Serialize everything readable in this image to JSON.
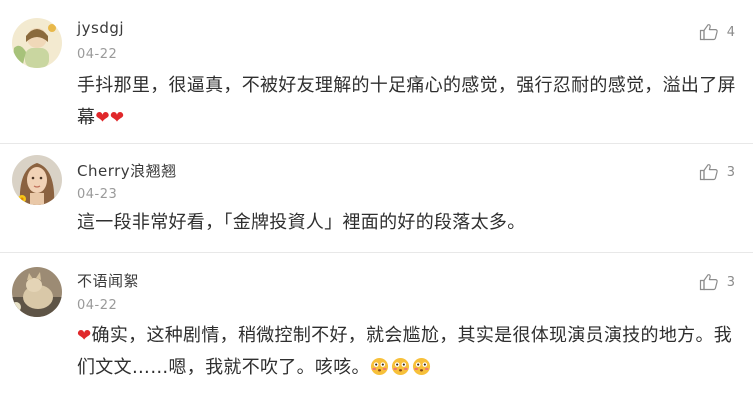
{
  "comments": [
    {
      "username": "jysdgj",
      "date": "04-22",
      "text": "手抖那里，很逼真，不被好友理解的十足痛心的感觉，强行忍耐的感觉，溢出了屏幕",
      "trailing_emoji": [
        "red-heart",
        "red-heart"
      ],
      "likes": "4",
      "avatar_icon": "avatar-illustration-icon"
    },
    {
      "username": "Cherry浪翘翘",
      "date": "04-23",
      "text": "這一段非常好看，「金牌投資人」裡面的好的段落太多。",
      "likes": "3",
      "avatar_icon": "avatar-portrait-icon"
    },
    {
      "username": "不语闻絮",
      "date": "04-22",
      "leading_emoji": "red-heart",
      "text": "确实，这种剧情，稍微控制不好，就会尴尬，其实是很体现演员演技的地方。我们文文……嗯，我就不吹了。咳咳。",
      "trailing_emoji": [
        "flushed-face",
        "flushed-face",
        "flushed-face"
      ],
      "likes": "3",
      "avatar_icon": "avatar-cat-icon"
    }
  ],
  "colors": {
    "heart": "#e0282b",
    "emoji_face": "#f7c03a",
    "divider": "#e8e8e8",
    "date": "#9a9a9a",
    "text": "#2f2f2f"
  }
}
